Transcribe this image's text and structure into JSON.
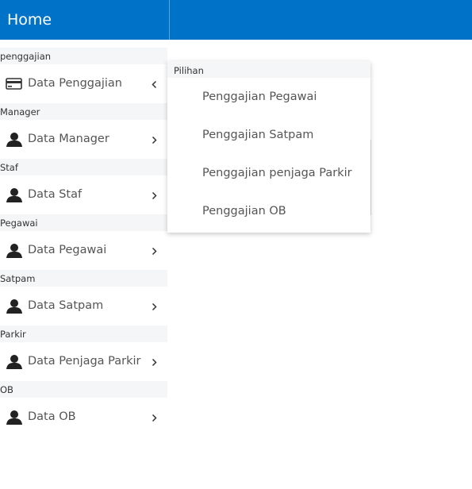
{
  "header": {
    "title": "Home"
  },
  "sidebar": {
    "groups": [
      {
        "header": "penggajian",
        "item": {
          "label": "Data Penggajian",
          "icon": "credit-card-icon",
          "chevron": "chevron-left-icon"
        }
      },
      {
        "header": "Manager",
        "item": {
          "label": "Data Manager",
          "icon": "user-icon",
          "chevron": "chevron-right-icon"
        }
      },
      {
        "header": "Staf",
        "item": {
          "label": "Data Staf",
          "icon": "user-icon",
          "chevron": "chevron-right-icon"
        }
      },
      {
        "header": "Pegawai",
        "item": {
          "label": "Data Pegawai",
          "icon": "user-icon",
          "chevron": "chevron-right-icon"
        }
      },
      {
        "header": "Satpam",
        "item": {
          "label": "Data Satpam",
          "icon": "user-icon",
          "chevron": "chevron-right-icon"
        }
      },
      {
        "header": "Parkir",
        "item": {
          "label": "Data Penjaga Parkir",
          "icon": "user-icon",
          "chevron": "chevron-right-icon"
        }
      },
      {
        "header": "OB",
        "item": {
          "label": "Data OB",
          "icon": "user-icon",
          "chevron": "chevron-right-icon"
        }
      }
    ]
  },
  "dropdown": {
    "header": "Pilihan",
    "options": [
      {
        "label": "Penggajian Pegawai"
      },
      {
        "label": "Penggajian Satpam"
      },
      {
        "label": "Penggajian penjaga Parkir"
      },
      {
        "label": "Penggajian OB"
      }
    ]
  },
  "colors": {
    "header_bg": "#0073c8",
    "group_bg": "#f5f6f8",
    "text": "#555555"
  }
}
